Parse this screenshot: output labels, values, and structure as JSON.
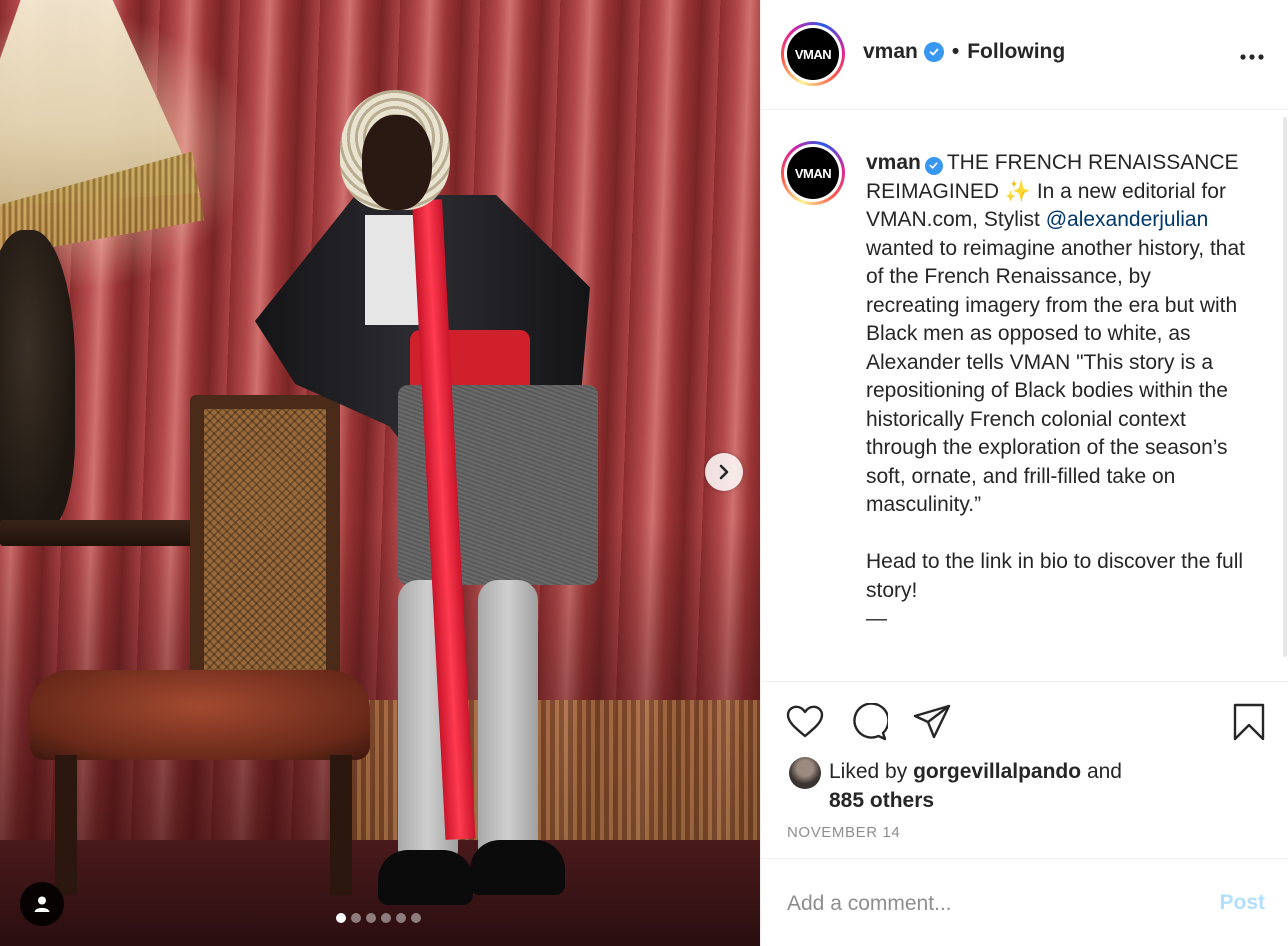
{
  "post": {
    "image_alt": "Editorial photo: model in powdered wig, black tailcoat, red sash and tie, grey shorts and tights, leaning on a caned chair before a red theatrical curtain with a lamp",
    "carousel": {
      "total": 6,
      "current": 1
    }
  },
  "header": {
    "avatar_text": "VMAN",
    "username": "vman",
    "separator": "•",
    "follow_status": "Following",
    "more_icon": "more-horizontal-icon"
  },
  "caption": {
    "avatar_text": "VMAN",
    "username": "vman",
    "text_before_mention": "THE FRENCH RENAISSANCE REIMAGINED ✨ In a new editorial for VMAN.com, Stylist ",
    "mention": "@alexanderjulian",
    "text_after_mention": " wanted to reimagine another history, that of the French Renaissance, by recreating imagery from the era but with Black men as opposed to white, as Alexander tells VMAN \"This story is a repositioning of Black bodies within the historically French colonial context through the exploration of the season’s soft, ornate, and frill-filled take on masculinity.”\n\nHead to the link in bio to discover the full story!\n—"
  },
  "actions": {
    "like_icon": "heart-icon",
    "comment_icon": "comment-icon",
    "share_icon": "share-icon",
    "save_icon": "bookmark-icon"
  },
  "likes": {
    "prefix": "Liked by",
    "user": "gorgevillalpando",
    "conjunction": "and",
    "others": "885 others"
  },
  "date": "NOVEMBER 14",
  "comment": {
    "placeholder": "Add a comment...",
    "post_label": "Post"
  },
  "colors": {
    "verified": "#3897f0",
    "mention": "#00376b",
    "post_button_disabled": "#b2dffc",
    "muted_text": "#8e8e8e"
  }
}
